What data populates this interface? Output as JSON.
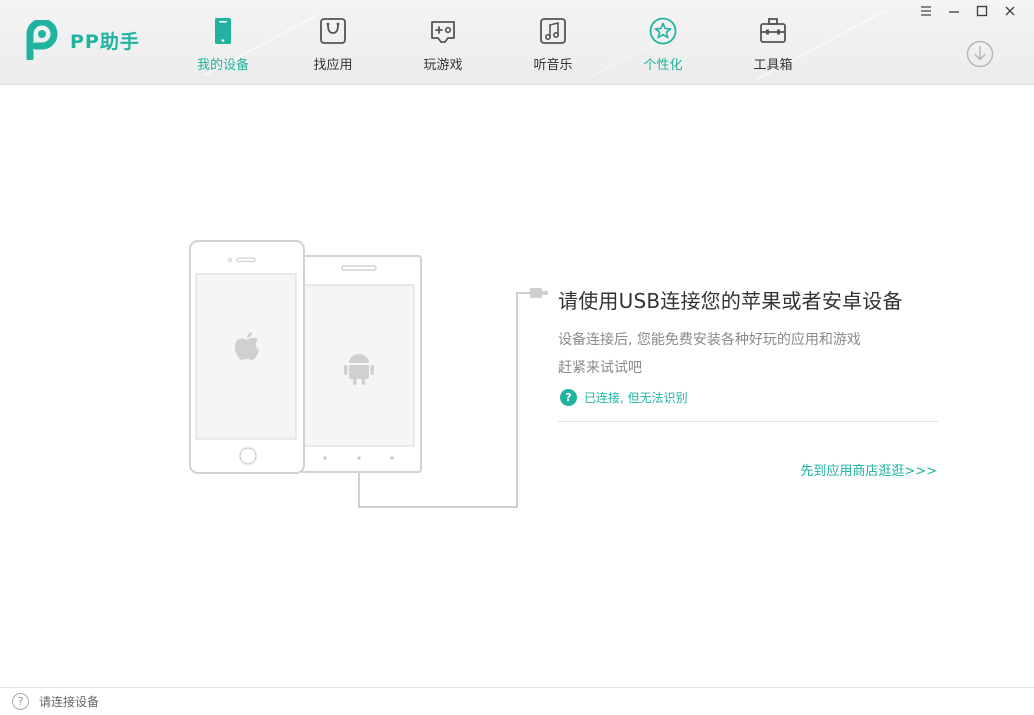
{
  "app": {
    "logo_text": "PP助手"
  },
  "nav": {
    "items": [
      {
        "label": "我的设备",
        "icon": "phone-icon",
        "active": true
      },
      {
        "label": "找应用",
        "icon": "shopping-bag-icon"
      },
      {
        "label": "玩游戏",
        "icon": "gamepad-icon"
      },
      {
        "label": "听音乐",
        "icon": "music-note-icon"
      },
      {
        "label": "个性化",
        "icon": "star-icon"
      },
      {
        "label": "工具箱",
        "icon": "toolbox-icon"
      }
    ]
  },
  "window_controls": [
    "menu-icon",
    "minimize-icon",
    "maximize-icon",
    "close-icon"
  ],
  "main": {
    "headline": "请使用USB连接您的苹果或者安卓设备",
    "desc_line1": "设备连接后, 您能免费安装各种好玩的应用和游戏",
    "desc_line2": "赶紧来试试吧",
    "help_icon": "?",
    "help_text": "已连接, 但无法识别",
    "store_link": "先到应用商店逛逛>>>"
  },
  "status": {
    "icon": "?",
    "text": "请连接设备"
  },
  "colors": {
    "accent": "#1fb3a0",
    "text": "#333333",
    "muted": "#8a8a8a"
  }
}
